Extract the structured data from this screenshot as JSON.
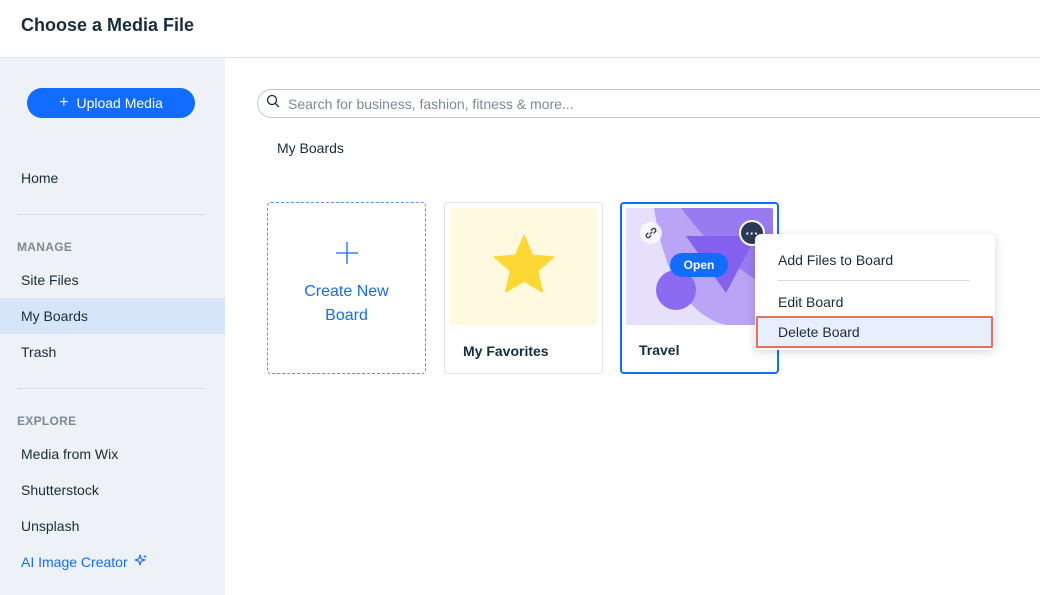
{
  "header": {
    "title": "Choose a Media File"
  },
  "sidebar": {
    "upload_label": "Upload Media",
    "home": "Home",
    "manage_heading": "MANAGE",
    "manage_items": [
      "Site Files",
      "My Boards",
      "Trash"
    ],
    "explore_heading": "EXPLORE",
    "explore_items": [
      "Media from Wix",
      "Shutterstock",
      "Unsplash"
    ],
    "ai_label": "AI Image Creator"
  },
  "search": {
    "placeholder": "Search for business, fashion, fitness & more..."
  },
  "breadcrumb": "My Boards",
  "boards": {
    "create_label": "Create New Board",
    "favorites_label": "My Favorites",
    "travel_label": "Travel",
    "open_label": "Open",
    "more_glyph": "···"
  },
  "context_menu": {
    "items": [
      "Add Files to Board",
      "Edit Board",
      "Delete Board"
    ]
  },
  "colors": {
    "accent": "#116dff",
    "sidebar_bg": "#eef1f6",
    "active_item_bg": "#d7e5fb",
    "highlight_border": "#e2735a",
    "star": "#fdd835"
  }
}
